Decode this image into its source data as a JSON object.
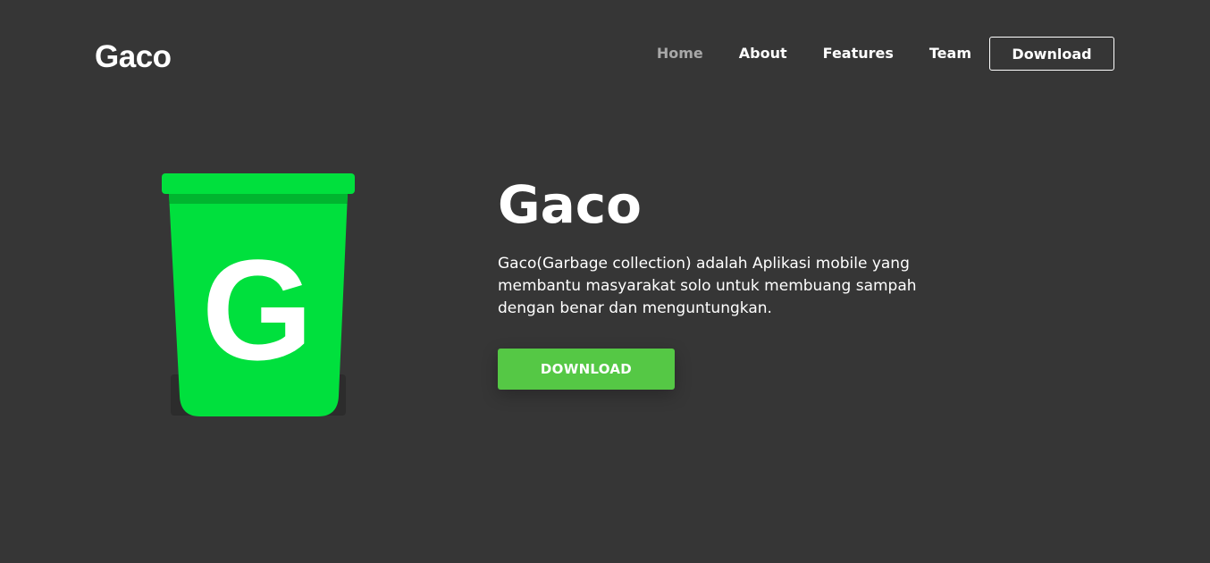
{
  "header": {
    "logo": "Gaco",
    "nav": [
      {
        "label": "Home",
        "active": true
      },
      {
        "label": "About",
        "active": false
      },
      {
        "label": "Features",
        "active": false
      },
      {
        "label": "Team",
        "active": false
      }
    ],
    "download_label": "Download"
  },
  "hero": {
    "title": "Gaco",
    "description": "Gaco(Garbage collection) adalah Aplikasi mobile yang membantu masyarakat solo untuk membuang sampah dengan benar dan menguntungkan.",
    "button_label": "DOWNLOAD",
    "illustration": {
      "icon": "trash-bin-icon",
      "letter": "G",
      "bin_color": "#00e03d",
      "rim_shadow_color": "#00b52f"
    }
  },
  "colors": {
    "background": "#363636",
    "accent_button": "#55c845",
    "nav_active": "#a8a8a8",
    "text": "#ffffff"
  }
}
